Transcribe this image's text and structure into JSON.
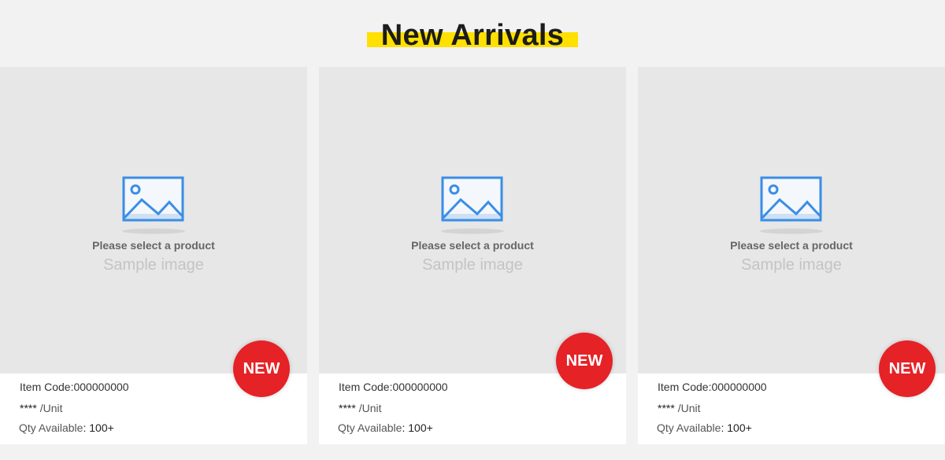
{
  "header": {
    "title": "New Arrivals",
    "highlight_color": "#ffe000"
  },
  "placeholder": {
    "icon": "image-placeholder-icon",
    "line1": "Please select a product",
    "line2": "Sample image"
  },
  "products": [
    {
      "badge": "NEW",
      "code_label": "Item Code:",
      "code": "000000000",
      "price": "****",
      "unit": "/Unit",
      "qty_label": "Qty Available",
      "qty_sep": ":",
      "qty": "100+"
    },
    {
      "badge": "NEW",
      "code_label": "Item Code:",
      "code": "000000000",
      "price": "****",
      "unit": "/Unit",
      "qty_label": "Qty Available",
      "qty_sep": ":",
      "qty": "100+"
    },
    {
      "badge": "NEW",
      "code_label": "Item Code:",
      "code": "000000000",
      "price": "****",
      "unit": "/Unit",
      "qty_label": "Qty Available",
      "qty_sep": ":",
      "qty": "100+"
    }
  ],
  "colors": {
    "badge": "#e52226",
    "accent": "#ffe000",
    "icon": "#3a8ee6"
  }
}
